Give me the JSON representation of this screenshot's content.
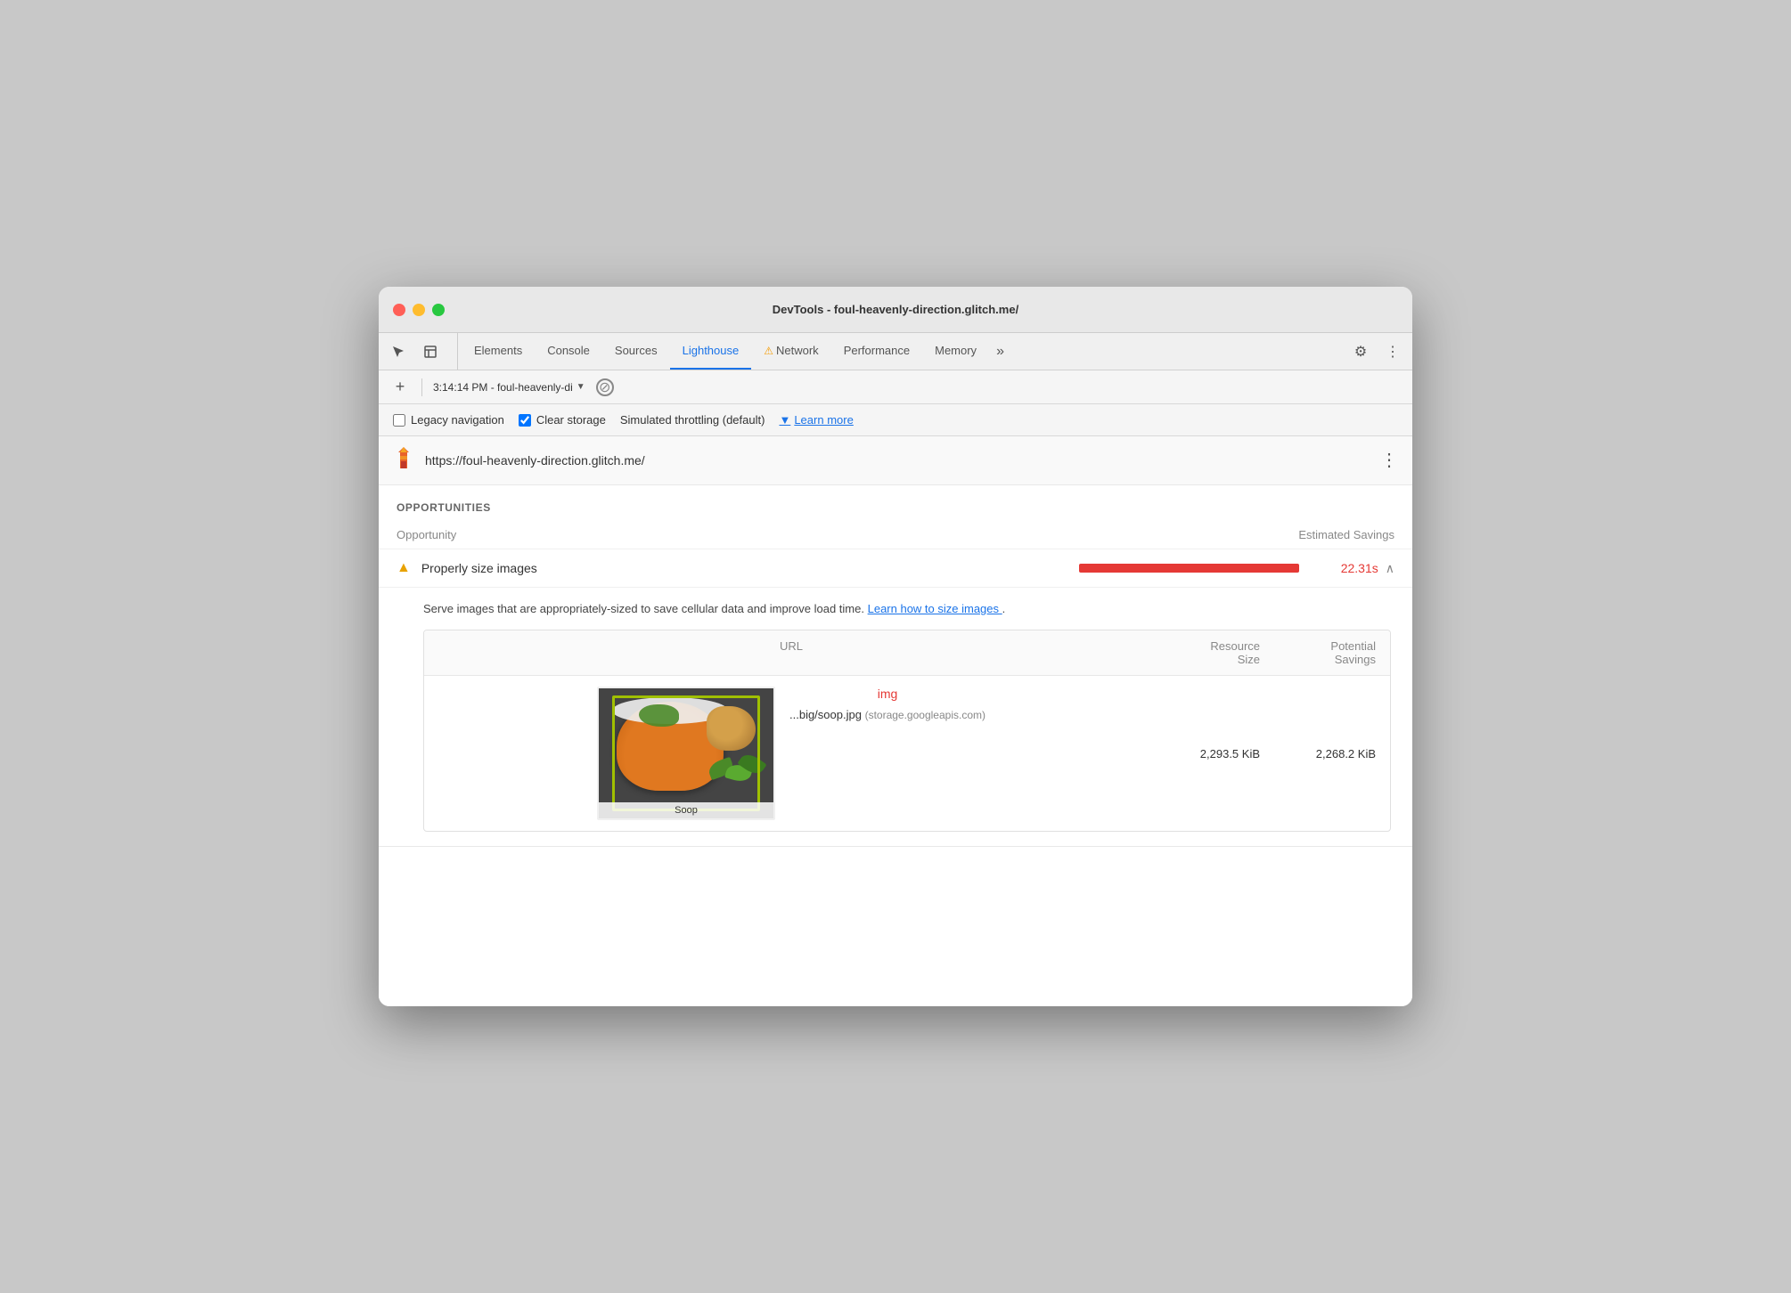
{
  "window": {
    "title": "DevTools - foul-heavenly-direction.glitch.me/"
  },
  "tabs": {
    "items": [
      {
        "label": "Elements",
        "active": false
      },
      {
        "label": "Console",
        "active": false
      },
      {
        "label": "Sources",
        "active": false
      },
      {
        "label": "Lighthouse",
        "active": true
      },
      {
        "label": "Network",
        "active": false,
        "warning": true
      },
      {
        "label": "Performance",
        "active": false
      },
      {
        "label": "Memory",
        "active": false
      }
    ],
    "more_label": "»",
    "settings_icon": "⚙",
    "more_icon": "⋮"
  },
  "secondary_toolbar": {
    "add_icon": "+",
    "session_label": "3:14:14 PM - foul-heavenly-di",
    "no_entry_icon": "⊘"
  },
  "options": {
    "legacy_navigation_label": "Legacy navigation",
    "legacy_navigation_checked": false,
    "clear_storage_label": "Clear storage",
    "clear_storage_checked": true,
    "throttling_label": "Simulated throttling (default)",
    "learn_more_label": "Learn more"
  },
  "site": {
    "url": "https://foul-heavenly-direction.glitch.me/",
    "lighthouse_icon": "🏠"
  },
  "opportunities": {
    "section_title": "OPPORTUNITIES",
    "col_opportunity": "Opportunity",
    "col_estimated_savings": "Estimated Savings",
    "items": [
      {
        "title": "Properly size images",
        "savings": "22.31s",
        "bar_width_percent": 95,
        "expanded": true
      }
    ]
  },
  "detail": {
    "description": "Serve images that are appropriately-sized to save cellular data and improve load time.",
    "link_text": "Learn how to size images",
    "table": {
      "col_url": "URL",
      "col_resource_size": "Resource\nSize",
      "col_potential_savings": "Potential\nSavings",
      "rows": [
        {
          "tag": "img",
          "url": "...big/soop.jpg",
          "source": "(storage.googleapis.com)",
          "resource_size": "2,293.5 KiB",
          "potential_savings": "2,268.2 KiB"
        }
      ]
    }
  }
}
